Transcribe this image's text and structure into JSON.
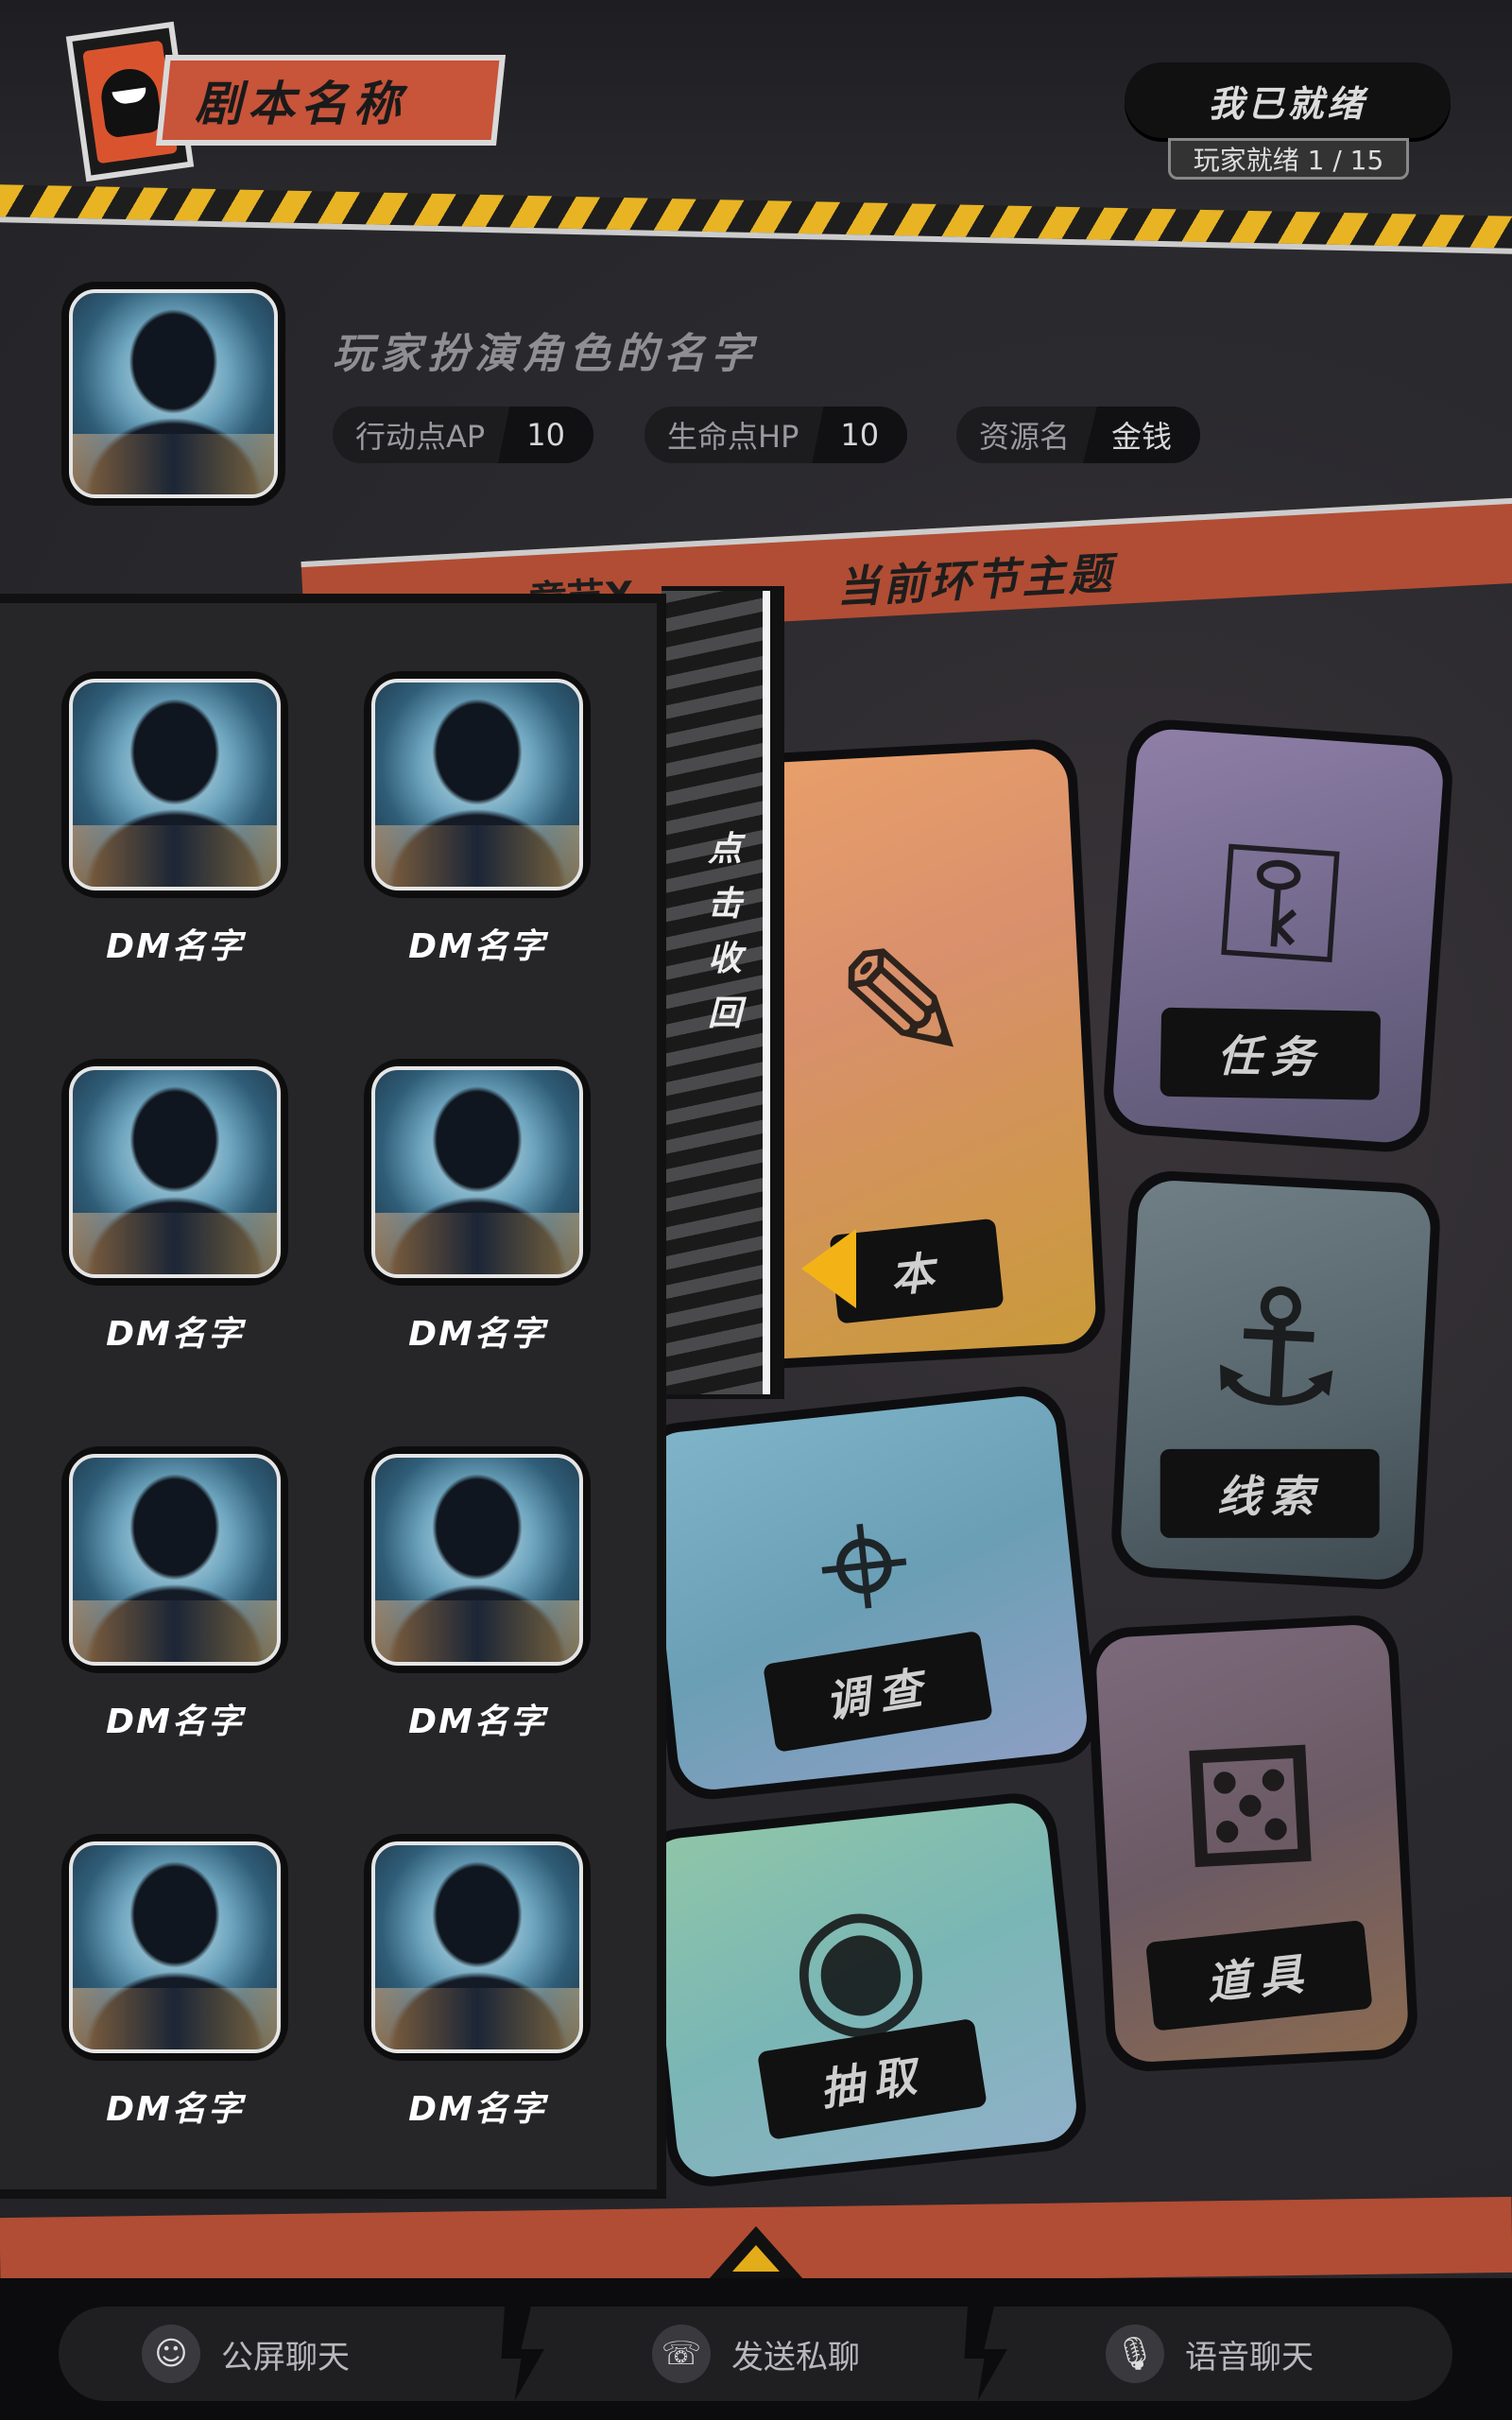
{
  "header": {
    "script_name": "剧本名称",
    "ready_button": "我已就绪",
    "ready_count": "玩家就绪 1 / 15"
  },
  "player": {
    "role_name": "玩家扮演角色的名字",
    "stats": [
      {
        "label": "行动点AP",
        "value": "10"
      },
      {
        "label": "生命点HP",
        "value": "10"
      },
      {
        "label": "资源名",
        "value": "金钱"
      }
    ]
  },
  "chapter": {
    "prev_label": "章节X",
    "title": "当前环节主题"
  },
  "cards": {
    "script": "本",
    "task": "任务",
    "clue": "线索",
    "investigate": "调查",
    "draw": "抽取",
    "props": "道具"
  },
  "drawer": {
    "collapse_label": "点击收回",
    "dms": [
      {
        "name": "DM名字"
      },
      {
        "name": "DM名字"
      },
      {
        "name": "DM名字"
      },
      {
        "name": "DM名字"
      },
      {
        "name": "DM名字"
      },
      {
        "name": "DM名字"
      },
      {
        "name": "DM名字"
      },
      {
        "name": "DM名字"
      }
    ]
  },
  "bottom_nav": {
    "public_chat": "公屏聊天",
    "private_chat": "发送私聊",
    "voice_chat": "语音聊天"
  },
  "icons": [
    "logo-mask-icon",
    "collapse-arrow-icon",
    "expand-up-icon",
    "public-chat-icon",
    "private-chat-icon",
    "microphone-icon"
  ],
  "colors": {
    "accent": "#b14d34",
    "hazard": "#e8b424",
    "collapse_arrow": "#f3b317"
  }
}
